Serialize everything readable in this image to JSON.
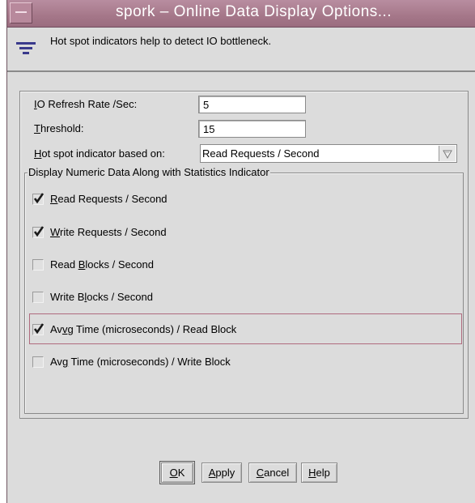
{
  "window": {
    "title": "spork – Online Data Display Options..."
  },
  "description": {
    "icon": "hotspot-indicator-icon",
    "text": "Hot spot indicators help to detect IO bottleneck."
  },
  "settings": {
    "refresh_rate": {
      "label_mnemonic": "I",
      "label_rest": "O Refresh Rate /Sec:",
      "value": "5"
    },
    "threshold": {
      "label_mnemonic": "T",
      "label_rest": "hreshold:",
      "value": "15"
    },
    "hotspot_basis": {
      "label_mnemonic": "H",
      "label_rest": "ot spot indicator based on:",
      "selected": "Read Requests / Second"
    }
  },
  "statistics_group": {
    "legend": "Display Numeric Data Along with Statistics Indicator",
    "items": [
      {
        "pre": "",
        "mn": "R",
        "post": "ead Requests / Second",
        "checked": true
      },
      {
        "pre": "",
        "mn": "W",
        "post": "rite Requests / Second",
        "checked": true
      },
      {
        "pre": "Read ",
        "mn": "B",
        "post": "locks / Second",
        "checked": false
      },
      {
        "pre": "Write B",
        "mn": "l",
        "post": "ocks / Second",
        "checked": false
      },
      {
        "pre": "Av",
        "mn": "v",
        "post": "g Time (microseconds) / Read Block",
        "checked": true
      },
      {
        "pre": "Av",
        "mn": "g",
        "post": " Time (microseconds) / Write Block",
        "checked": false
      }
    ]
  },
  "buttons": {
    "ok": {
      "mn": "O",
      "rest": "K"
    },
    "apply": {
      "mn": "A",
      "rest": "pply"
    },
    "cancel": {
      "mn": "C",
      "rest": "ancel"
    },
    "help": {
      "mn": "H",
      "rest": "elp"
    }
  },
  "colors": {
    "titlebar": "#a57789",
    "window_bg": "#dcdcdc",
    "focus_border": "#b06b7f"
  }
}
